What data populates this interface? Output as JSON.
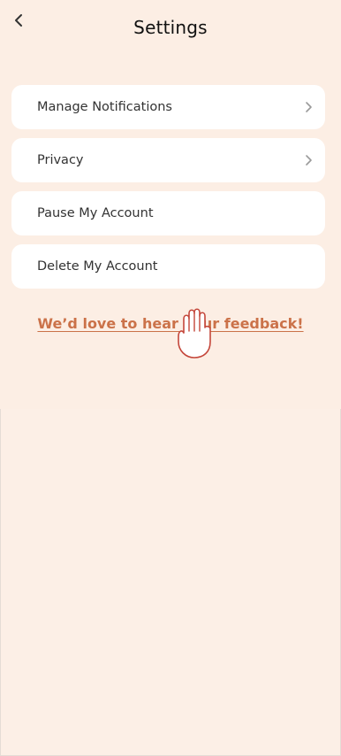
{
  "header": {
    "title": "Settings",
    "back_icon": "chevron-left-icon"
  },
  "menu": {
    "items": [
      {
        "label": "Manage Notifications",
        "has_chevron": true
      },
      {
        "label": "Privacy",
        "has_chevron": true
      },
      {
        "label": "Pause My Account",
        "has_chevron": false
      },
      {
        "label": "Delete My Account",
        "has_chevron": false
      }
    ]
  },
  "feedback": {
    "label": "We’d love to hear your feedback!"
  },
  "overlay": {
    "cursor_icon": "hand-pointer-icon"
  },
  "colors": {
    "background": "#fceee4",
    "card": "#ffffff",
    "accent": "#cb7249"
  }
}
